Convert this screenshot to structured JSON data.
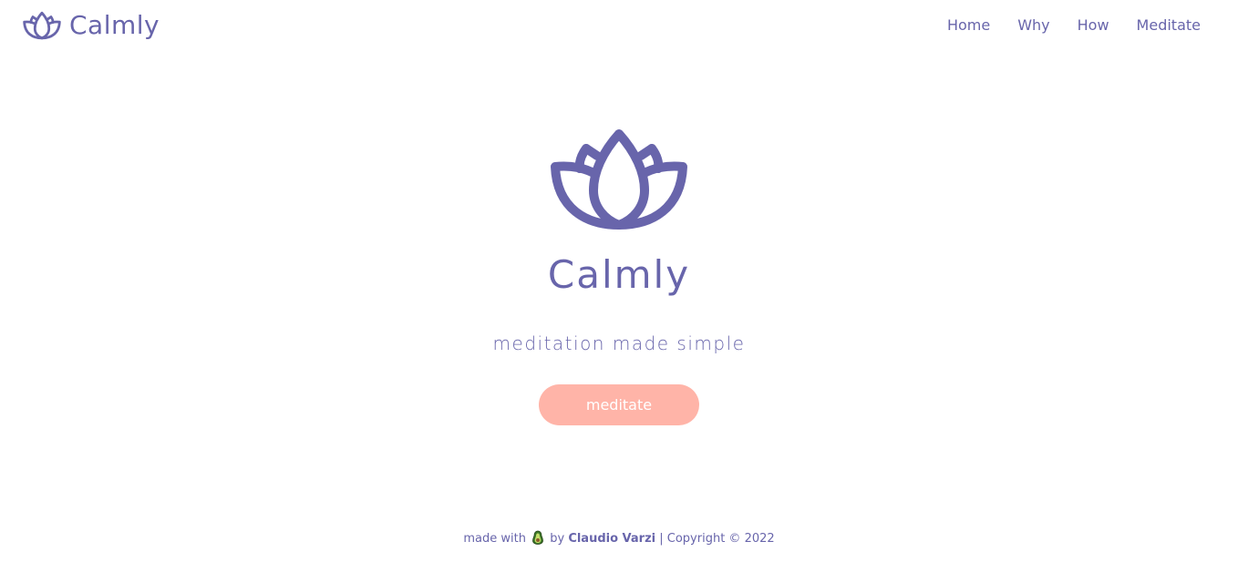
{
  "brand": {
    "name": "Calmly",
    "icon": "lotus-icon",
    "color": "#6865ab"
  },
  "nav": {
    "items": [
      {
        "label": "Home"
      },
      {
        "label": "Why"
      },
      {
        "label": "How"
      },
      {
        "label": "Meditate"
      }
    ]
  },
  "hero": {
    "icon": "lotus-icon",
    "title": "Calmly",
    "tagline": "meditation made simple",
    "cta_label": "meditate",
    "cta_color": "#ffb4a8"
  },
  "footer": {
    "prefix": "made with",
    "icon": "avocado-emoji-icon",
    "by": "by",
    "author": "Claudio Varzi",
    "copyright": "| Copyright © 2022"
  }
}
